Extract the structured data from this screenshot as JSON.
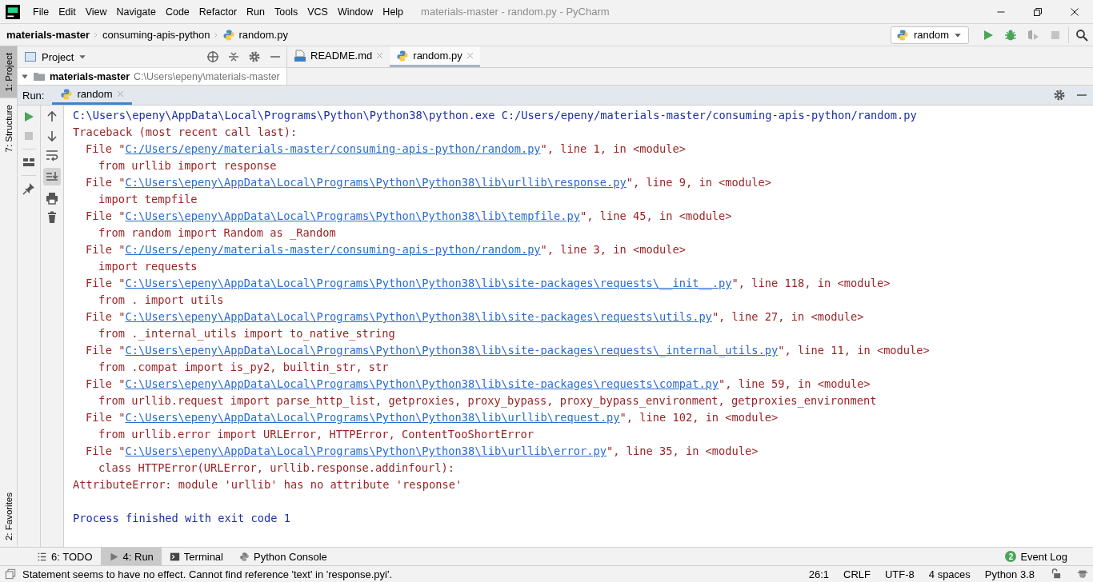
{
  "window": {
    "title": "materials-master - random.py - PyCharm"
  },
  "menu": [
    "File",
    "Edit",
    "View",
    "Navigate",
    "Code",
    "Refactor",
    "Run",
    "Tools",
    "VCS",
    "Window",
    "Help"
  ],
  "breadcrumbs": [
    {
      "label": "materials-master",
      "kind": "project"
    },
    {
      "label": "consuming-apis-python",
      "kind": "folder"
    },
    {
      "label": "random.py",
      "kind": "file"
    }
  ],
  "run_config": {
    "label": "random"
  },
  "left_tool_tabs_top": [
    {
      "label": "1: Project",
      "selected": true
    },
    {
      "label": "7: Structure",
      "selected": false
    }
  ],
  "left_tool_tabs_bottom": [
    {
      "label": "2: Favorites",
      "selected": false
    }
  ],
  "project_panel": {
    "title": "Project",
    "tree": [
      {
        "label": "materials-master",
        "path": "C:\\Users\\epeny\\materials-master",
        "expanded": true
      }
    ]
  },
  "editor_tabs": [
    {
      "label": "README.md",
      "kind": "markdown",
      "selected": false
    },
    {
      "label": "random.py",
      "kind": "python",
      "selected": true
    }
  ],
  "run_panel": {
    "label": "Run:",
    "tabs": [
      {
        "label": "random",
        "selected": true
      }
    ],
    "console": [
      {
        "kind": "command",
        "text": "C:\\Users\\epeny\\AppData\\Local\\Programs\\Python\\Python38\\python.exe C:/Users/epeny/materials-master/consuming-apis-python/random.py"
      },
      {
        "kind": "error",
        "text": "Traceback (most recent call last):"
      },
      {
        "kind": "file",
        "prefix": "File \"",
        "link": "C:/Users/epeny/materials-master/consuming-apis-python/random.py",
        "suffix": "\", line 1, in <module>"
      },
      {
        "kind": "code",
        "text": "from urllib import response"
      },
      {
        "kind": "file",
        "prefix": "File \"",
        "link": "C:\\Users\\epeny\\AppData\\Local\\Programs\\Python\\Python38\\lib\\urllib\\response.py",
        "suffix": "\", line 9, in <module>"
      },
      {
        "kind": "code",
        "text": "import tempfile"
      },
      {
        "kind": "file",
        "prefix": "File \"",
        "link": "C:\\Users\\epeny\\AppData\\Local\\Programs\\Python\\Python38\\lib\\tempfile.py",
        "suffix": "\", line 45, in <module>"
      },
      {
        "kind": "code",
        "text": "from random import Random as _Random"
      },
      {
        "kind": "file",
        "prefix": "File \"",
        "link": "C:/Users/epeny/materials-master/consuming-apis-python/random.py",
        "suffix": "\", line 3, in <module>"
      },
      {
        "kind": "code",
        "text": "import requests"
      },
      {
        "kind": "file",
        "prefix": "File \"",
        "link": "C:\\Users\\epeny\\AppData\\Local\\Programs\\Python\\Python38\\lib\\site-packages\\requests\\__init__.py",
        "suffix": "\", line 118, in <module>"
      },
      {
        "kind": "code",
        "text": "from . import utils"
      },
      {
        "kind": "file",
        "prefix": "File \"",
        "link": "C:\\Users\\epeny\\AppData\\Local\\Programs\\Python\\Python38\\lib\\site-packages\\requests\\utils.py",
        "suffix": "\", line 27, in <module>"
      },
      {
        "kind": "code",
        "text": "from ._internal_utils import to_native_string"
      },
      {
        "kind": "file",
        "prefix": "File \"",
        "link": "C:\\Users\\epeny\\AppData\\Local\\Programs\\Python\\Python38\\lib\\site-packages\\requests\\_internal_utils.py",
        "suffix": "\", line 11, in <module>"
      },
      {
        "kind": "code",
        "text": "from .compat import is_py2, builtin_str, str"
      },
      {
        "kind": "file",
        "prefix": "File \"",
        "link": "C:\\Users\\epeny\\AppData\\Local\\Programs\\Python\\Python38\\lib\\site-packages\\requests\\compat.py",
        "suffix": "\", line 59, in <module>"
      },
      {
        "kind": "code",
        "text": "from urllib.request import parse_http_list, getproxies, proxy_bypass, proxy_bypass_environment, getproxies_environment"
      },
      {
        "kind": "file",
        "prefix": "File \"",
        "link": "C:\\Users\\epeny\\AppData\\Local\\Programs\\Python\\Python38\\lib\\urllib\\request.py",
        "suffix": "\", line 102, in <module>"
      },
      {
        "kind": "code",
        "text": "from urllib.error import URLError, HTTPError, ContentTooShortError"
      },
      {
        "kind": "file",
        "prefix": "File \"",
        "link": "C:\\Users\\epeny\\AppData\\Local\\Programs\\Python\\Python38\\lib\\urllib\\error.py",
        "suffix": "\", line 35, in <module>"
      },
      {
        "kind": "code",
        "text": "class HTTPError(URLError, urllib.response.addinfourl):"
      },
      {
        "kind": "error",
        "text": "AttributeError: module 'urllib' has no attribute 'response'"
      },
      {
        "kind": "blank"
      },
      {
        "kind": "command",
        "text": "Process finished with exit code 1"
      }
    ]
  },
  "bottom_tool_tabs": [
    {
      "label": "6: TODO",
      "kind": "todo",
      "selected": false
    },
    {
      "label": "4: Run",
      "kind": "run",
      "selected": true
    },
    {
      "label": "Terminal",
      "kind": "terminal",
      "selected": false
    },
    {
      "label": "Python Console",
      "kind": "python",
      "selected": false
    }
  ],
  "event_log": {
    "count": "2",
    "label": "Event Log"
  },
  "status_bar": {
    "message": "Statement seems to have no effect. Cannot find reference 'text' in 'response.pyi'.",
    "items": [
      "26:1",
      "CRLF",
      "UTF-8",
      "4 spaces",
      "Python 3.8"
    ]
  }
}
